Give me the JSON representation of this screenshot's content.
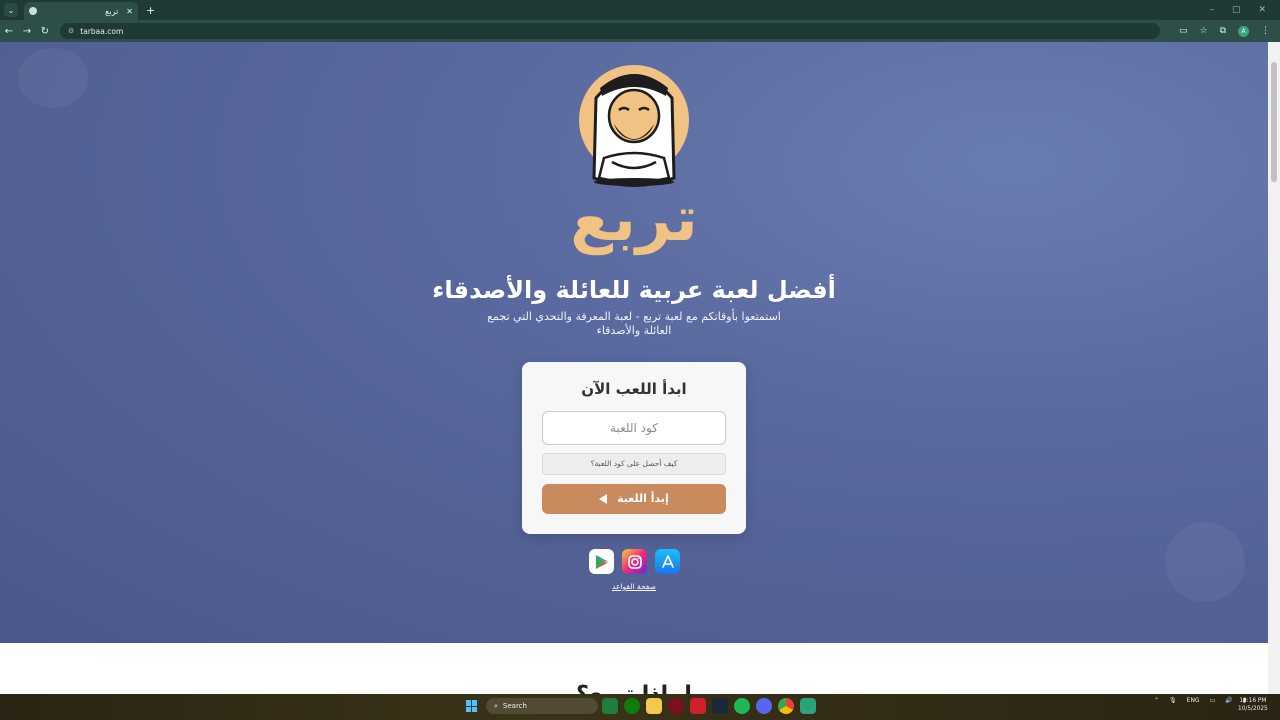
{
  "browser": {
    "tab_title": "تربع",
    "tab_menu_glyph": "⌄",
    "new_tab_glyph": "+",
    "url": "tarbaa.com",
    "window_controls": [
      "–",
      "▢",
      "✕"
    ],
    "profile_initial": "A"
  },
  "page": {
    "brand": "تربع",
    "headline": "أفضل لعبة عربية للعائلة والأصدقاء",
    "subline": "استمتعوا بأوقاتكم مع لعبة تربع - لعبة المعرفة والتحدي التي تجمع العائلة والأصدقاء",
    "card": {
      "title": "ابدأ اللعب الآن",
      "code_placeholder": "كود اللعبة",
      "help_label": "كيف أحصل على كود اللعبة؟",
      "start_label": "إبدأ اللعبة"
    },
    "stores": [
      {
        "name": "google-play-icon"
      },
      {
        "name": "instagram-icon"
      },
      {
        "name": "app-store-icon"
      }
    ],
    "rules_link": "صفحة القواعد",
    "bottom_heading": "لماذا تربع؟"
  },
  "taskbar": {
    "search_label": "Search",
    "lang": "ENG",
    "time": "10:16 PM",
    "date": "10/5/2025"
  },
  "colors": {
    "hero_bg": "#59689e",
    "brand": "#f0c283",
    "start_button": "#c98a5e",
    "browser_frame": "#2e4f48"
  }
}
